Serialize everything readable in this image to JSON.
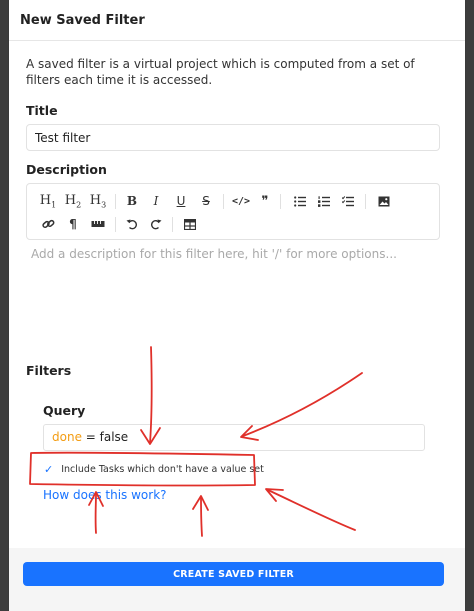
{
  "modal": {
    "title": "New Saved Filter",
    "intro": "A saved filter is a virtual project which is computed from a set of filters each time it is accessed."
  },
  "title_field": {
    "label": "Title",
    "value": "Test filter"
  },
  "description_field": {
    "label": "Description",
    "placeholder": "Add a description for this filter here, hit '/' for more options..."
  },
  "toolbar": {
    "h1": "H",
    "h1_sub": "1",
    "h2": "H",
    "h2_sub": "2",
    "h3": "H",
    "h3_sub": "3",
    "bold": "B",
    "italic": "I",
    "underline": "U",
    "strike": "S",
    "code": "</>",
    "quote": "❞",
    "paragraph": "¶"
  },
  "filters": {
    "label": "Filters",
    "query_label": "Query",
    "query_keyword": "done",
    "query_rest": " = false",
    "checkbox_label": "Include Tasks which don't have a value set",
    "checkbox_checked": true,
    "help_link": "How does this work?"
  },
  "footer": {
    "create_button": "CREATE SAVED FILTER"
  },
  "colors": {
    "accent": "#1973ff",
    "keyword": "#f39c12",
    "annotation": "#e0302a"
  }
}
